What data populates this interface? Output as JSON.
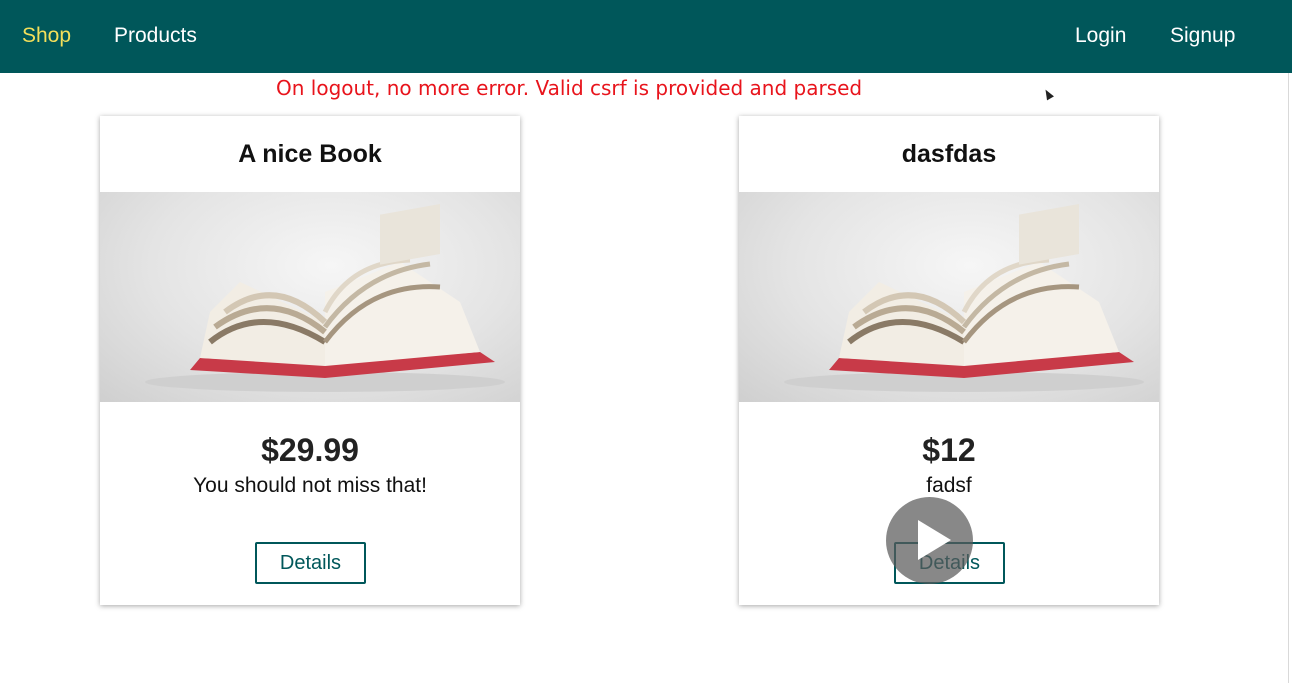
{
  "nav": {
    "shop": "Shop",
    "products": "Products",
    "login": "Login",
    "signup": "Signup"
  },
  "annotation": "On logout, no more error. Valid csrf is provided and parsed",
  "products": [
    {
      "title": "A nice Book",
      "price": "$29.99",
      "description": "You should not miss that!",
      "button": "Details",
      "image_icon": "open-book-image"
    },
    {
      "title": "dasfdas",
      "price": "$12",
      "description": "fadsf",
      "button": "Details",
      "image_icon": "open-book-image"
    }
  ],
  "colors": {
    "header": "#00575a",
    "active_nav": "#f3df5a",
    "annotation": "#e8141c",
    "button_border": "#00575a"
  },
  "overlay_icon": "play-icon"
}
